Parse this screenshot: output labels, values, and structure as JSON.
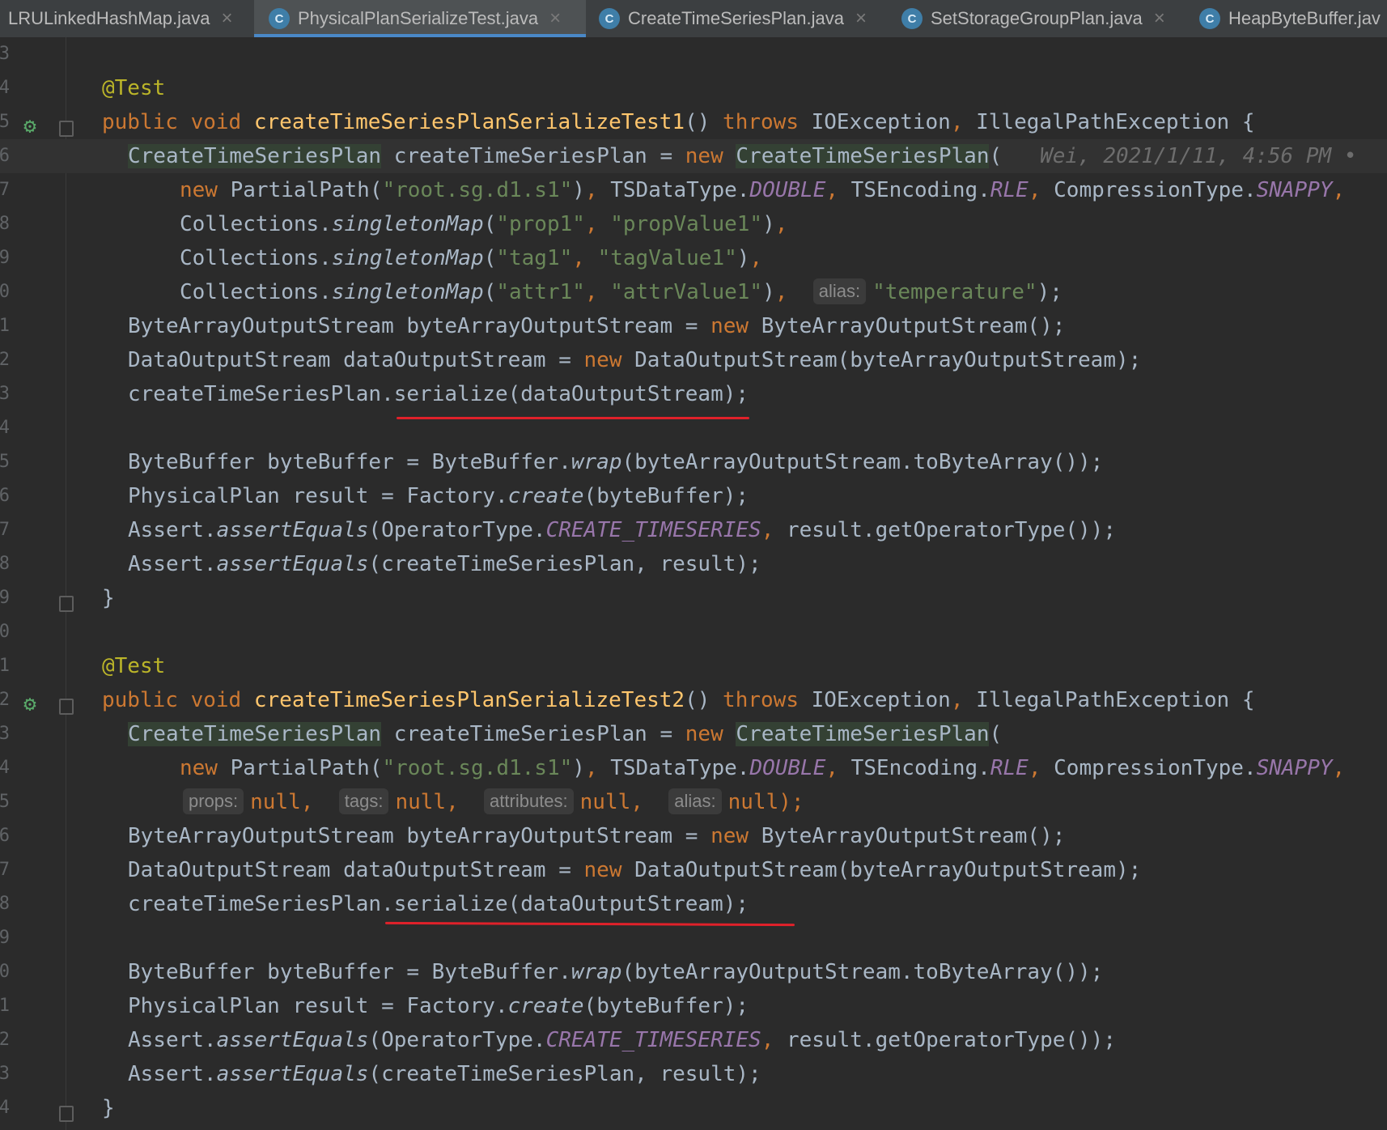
{
  "tabs": [
    {
      "label": "LRULinkedHashMap.java",
      "active": false,
      "icon": "none"
    },
    {
      "label": "PhysicalPlanSerializeTest.java",
      "active": true,
      "icon": "class-icon"
    },
    {
      "label": "CreateTimeSeriesPlan.java",
      "active": false,
      "icon": "class-icon"
    },
    {
      "label": "SetStorageGroupPlan.java",
      "active": false,
      "icon": "class-icon"
    },
    {
      "label": "HeapByteBuffer.jav",
      "active": false,
      "icon": "locked-class-icon"
    }
  ],
  "tab_close_glyph": "×",
  "class_icon_glyph": "C",
  "line_numbers": [
    "3",
    "4",
    "5",
    "6",
    "7",
    "8",
    "9",
    "0",
    "1",
    "2",
    "3",
    "4",
    "5",
    "6",
    "7",
    "8",
    "9",
    "0",
    "1",
    "2",
    "3",
    "4",
    "5",
    "6",
    "7",
    "8",
    "9",
    "0",
    "1",
    "2",
    "3",
    "4"
  ],
  "code": {
    "annotation": "@Test",
    "kw_public": "public",
    "kw_void": "void",
    "kw_throws": "throws",
    "kw_new": "new",
    "method1": "createTimeSeriesPlanSerializeTest1",
    "method2": "createTimeSeriesPlanSerializeTest2",
    "sig_parens": "()",
    "sig_exceptions_1": "IOException",
    "comma": ",",
    "sig_exceptions_2": "IllegalPathException",
    "open_brace": "{",
    "close_brace": "}",
    "type_ctsp": "CreateTimeSeriesPlan",
    "var_ctsp": "createTimeSeriesPlan",
    "assign": "=",
    "paren_open": "(",
    "paren_close": ")",
    "blame": "Wei, 2021/1/11, 4:56 PM •",
    "partial_path": "PartialPath",
    "path_str": "\"root.sg.d1.s1\"",
    "tsdatatype": "TSDataType.",
    "double": "DOUBLE",
    "tsencoding": "TSEncoding.",
    "rle": "RLE",
    "compression": "CompressionType.",
    "snappy": "SNAPPY",
    "collections": "Collections.",
    "singleton": "singletonMap",
    "prop_key": "\"prop1\"",
    "prop_val": "\"propValue1\"",
    "tag_key": "\"tag1\"",
    "tag_val": "\"tagValue1\"",
    "attr_key": "\"attr1\"",
    "attr_val": "\"attrValue1\"",
    "hint_alias": "alias:",
    "alias_val": "\"temperature\"",
    "end_stmt": ");",
    "semicolon": ";",
    "baos_decl": "ByteArrayOutputStream byteArrayOutputStream = ",
    "baos_ctor": "ByteArrayOutputStream",
    "empty_call_end": "();",
    "dos_decl": "DataOutputStream dataOutputStream = ",
    "dos_ctor": "DataOutputStream",
    "baos_arg": "byteArrayOutputStream",
    "serialize_target": "createTimeSeriesPlan.",
    "serialize": "serialize",
    "dos_arg": "dataOutputStream",
    "bb_decl": "ByteBuffer byteBuffer = ByteBuffer.",
    "wrap": "wrap",
    "to_byte_array": "byteArrayOutputStream.toByteArray",
    "double_close": "());",
    "result_decl": "PhysicalPlan result = Factory.",
    "create": "create",
    "bb_arg": "byteBuffer",
    "assert_prefix": "Assert.",
    "assert_equals": "assertEquals",
    "optype": "OperatorType.",
    "create_ts": "CREATE_TIMESERIES",
    "get_optype": "result.getOperatorType",
    "assert2_args": "createTimeSeriesPlan, result",
    "hint_props": "props:",
    "hint_tags": "tags:",
    "hint_attributes": "attributes:",
    "null": "null",
    "null_end": "null);"
  },
  "colors": {
    "background": "#2b2b2b",
    "keyword": "#cc7832",
    "annotation": "#bbb529",
    "method": "#ffc66d",
    "string": "#6a8759",
    "constant": "#9876aa",
    "text": "#a9b7c6",
    "underline": "#e0212a",
    "run_icon": "#59a869"
  },
  "icons": [
    "run-test-icon",
    "fold-icon",
    "lightbulb-icon",
    "class-icon"
  ]
}
